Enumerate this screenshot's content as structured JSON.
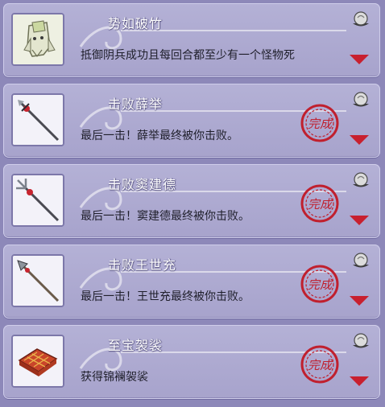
{
  "achievements": [
    {
      "title": "势如破竹",
      "description": "抵御阴兵成功且每回合都至少有一个怪物死",
      "completed": false,
      "icon": "ghost-robe-icon"
    },
    {
      "title": "击败薛举",
      "description": "最后一击！薛举最终被你击败。",
      "completed": true,
      "stamp_text": "完成",
      "icon": "spear-icon"
    },
    {
      "title": "击败窦建德",
      "description": "最后一击！窦建德最终被你击败。",
      "completed": true,
      "stamp_text": "完成",
      "icon": "trident-icon"
    },
    {
      "title": "击败王世充",
      "description": "最后一击！王世充最终被你击败。",
      "completed": true,
      "stamp_text": "完成",
      "icon": "lance-icon"
    },
    {
      "title": "至宝袈裟",
      "description": "获得锦襕袈裟",
      "completed": true,
      "stamp_text": "完成",
      "icon": "kasaya-icon"
    }
  ],
  "colors": {
    "panel": "#a9a5cf",
    "stamp": "#c0202e",
    "arrow": "#c8202f"
  }
}
